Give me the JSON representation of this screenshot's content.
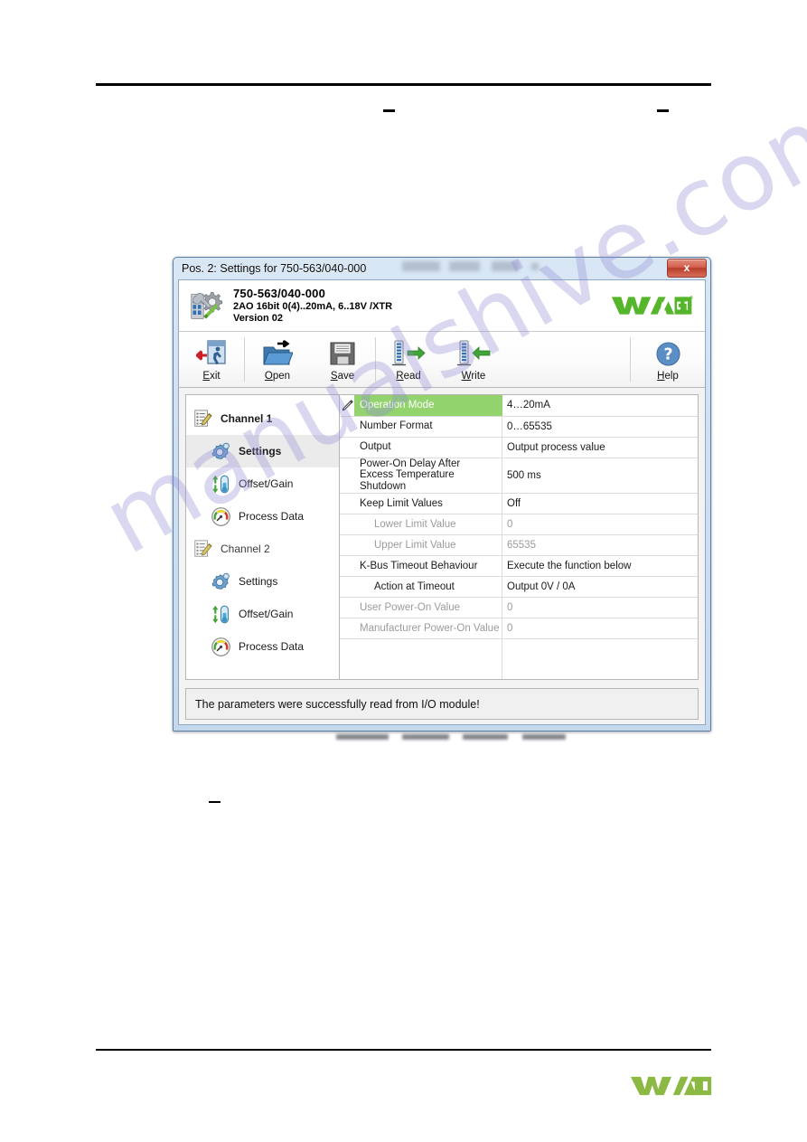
{
  "dialog": {
    "titlebar": {
      "title": "Pos. 2: Settings for 750-563/040-000",
      "close_label": "x"
    },
    "module": {
      "name": "750-563/040-000",
      "description": "2AO 16bit 0(4)..20mA, 6..18V /XTR",
      "version": "Version 02",
      "logo_text": "WAGO",
      "logo_registered": "®",
      "icon": "module-settings-icon"
    },
    "toolbar": {
      "buttons": [
        {
          "id": "exit",
          "label": "Exit",
          "accel": "E",
          "icon": "exit-door-arrow-icon"
        },
        {
          "id": "open",
          "label": "Open",
          "accel": "O",
          "icon": "folder-open-arrow-icon"
        },
        {
          "id": "save",
          "label": "Save",
          "accel": "S",
          "icon": "floppy-disk-icon"
        },
        {
          "id": "read",
          "label": "Read",
          "accel": "R",
          "icon": "module-arrow-right-icon"
        },
        {
          "id": "write",
          "label": "Write",
          "accel": "W",
          "icon": "module-arrow-left-icon"
        },
        {
          "id": "help",
          "label": "Help",
          "accel": "H",
          "icon": "question-mark-circle-icon"
        }
      ]
    },
    "tree": {
      "nodes": [
        {
          "label": "Channel 1",
          "level": 0,
          "icon": "channel-document-icon",
          "selected": false,
          "bold": true
        },
        {
          "label": "Settings",
          "level": 1,
          "icon": "gear-icon",
          "selected": true,
          "bold": true
        },
        {
          "label": "Offset/Gain",
          "level": 1,
          "icon": "offset-gain-icon",
          "selected": false,
          "bold": false
        },
        {
          "label": "Process Data",
          "level": 1,
          "icon": "gauge-icon",
          "selected": false,
          "bold": false
        },
        {
          "label": "Channel 2",
          "level": 0,
          "icon": "channel-document-icon",
          "selected": false,
          "bold": false
        },
        {
          "label": "Settings",
          "level": 1,
          "icon": "gear-icon",
          "selected": false,
          "bold": false
        },
        {
          "label": "Offset/Gain",
          "level": 1,
          "icon": "offset-gain-icon",
          "selected": false,
          "bold": false
        },
        {
          "label": "Process Data",
          "level": 1,
          "icon": "gauge-icon",
          "selected": false,
          "bold": false
        }
      ]
    },
    "parameters": {
      "edit_marker_icon": "pencil-icon",
      "rows": [
        {
          "name": "Operation Mode",
          "value": "4…20mA",
          "selected": true,
          "indent": 0,
          "dim": false,
          "tall": false,
          "marker": true
        },
        {
          "name": "Number Format",
          "value": "0…65535",
          "selected": false,
          "indent": 0,
          "dim": false,
          "tall": false,
          "marker": false
        },
        {
          "name": "Output",
          "value": "Output process value",
          "selected": false,
          "indent": 0,
          "dim": false,
          "tall": false,
          "marker": false
        },
        {
          "name": "Power-On Delay After Excess Temperature Shutdown",
          "name_line1": "Power-On Delay After",
          "name_line2": "Excess Temperature Shutdown",
          "value": "500 ms",
          "selected": false,
          "indent": 0,
          "dim": false,
          "tall": true,
          "marker": false
        },
        {
          "name": "Keep Limit Values",
          "value": "Off",
          "selected": false,
          "indent": 0,
          "dim": false,
          "tall": false,
          "marker": false
        },
        {
          "name": "Lower Limit Value",
          "value": "0",
          "selected": false,
          "indent": 1,
          "dim": true,
          "tall": false,
          "marker": false
        },
        {
          "name": "Upper Limit Value",
          "value": "65535",
          "selected": false,
          "indent": 1,
          "dim": true,
          "tall": false,
          "marker": false
        },
        {
          "name": "K-Bus Timeout Behaviour",
          "value": "Execute the function below",
          "selected": false,
          "indent": 0,
          "dim": false,
          "tall": false,
          "marker": false
        },
        {
          "name": "Action at Timeout",
          "value": "Output 0V / 0A",
          "selected": false,
          "indent": 1,
          "dim": false,
          "tall": false,
          "marker": false
        },
        {
          "name": "User Power-On Value",
          "value": "0",
          "selected": false,
          "indent": 0,
          "dim": true,
          "tall": false,
          "marker": false
        },
        {
          "name": "Manufacturer Power-On Value",
          "value": "0",
          "selected": false,
          "indent": 0,
          "dim": true,
          "tall": false,
          "marker": false
        }
      ]
    },
    "status": {
      "message": "The parameters were successfully read from I/O module!"
    }
  },
  "page": {
    "footer_logo_text": "WAGO",
    "watermark": "manualshive.com"
  },
  "colors": {
    "selection_green": "#92d36e",
    "wago_green": "#6cb933",
    "wago_footer_green": "#8cb944",
    "close_red": "#c1452f",
    "titlebar_blue": "#cfe0f2"
  }
}
